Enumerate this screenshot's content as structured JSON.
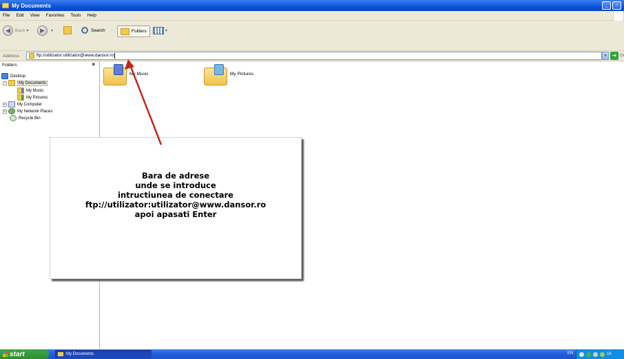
{
  "window": {
    "title": "My Documents"
  },
  "menu": [
    "File",
    "Edit",
    "View",
    "Favorites",
    "Tools",
    "Help"
  ],
  "toolbar": {
    "back_label": "Back",
    "search_label": "Search",
    "folders_label": "Folders"
  },
  "address": {
    "label": "Address",
    "value": "ftp://utilizator:utilizator@www.dansor.ro",
    "go_label": "Go"
  },
  "folders_pane": {
    "title": "Folders",
    "items": [
      {
        "label": "Desktop"
      },
      {
        "label": "My Documents"
      },
      {
        "label": "My Music"
      },
      {
        "label": "My Pictures"
      },
      {
        "label": "My Computer"
      },
      {
        "label": "My Network Places"
      },
      {
        "label": "Recycle Bin"
      }
    ]
  },
  "content": {
    "items": [
      {
        "label": "My Music"
      },
      {
        "label": "My Pictures"
      }
    ]
  },
  "callout": {
    "lines": [
      "Bara de adrese",
      "unde se introduce",
      "intructiunea de conectare",
      "ftp://utilizator:utilizator@www.dansor.ro",
      "apoi apasati Enter"
    ]
  },
  "taskbar": {
    "start_label": "start",
    "task_label": "My Documents",
    "lang": "EN",
    "clock": "16"
  },
  "colors": {
    "titlebar": "#0a52d8",
    "taskbar": "#245edb",
    "start": "#2e8d30",
    "arrow": "#c0281c"
  }
}
